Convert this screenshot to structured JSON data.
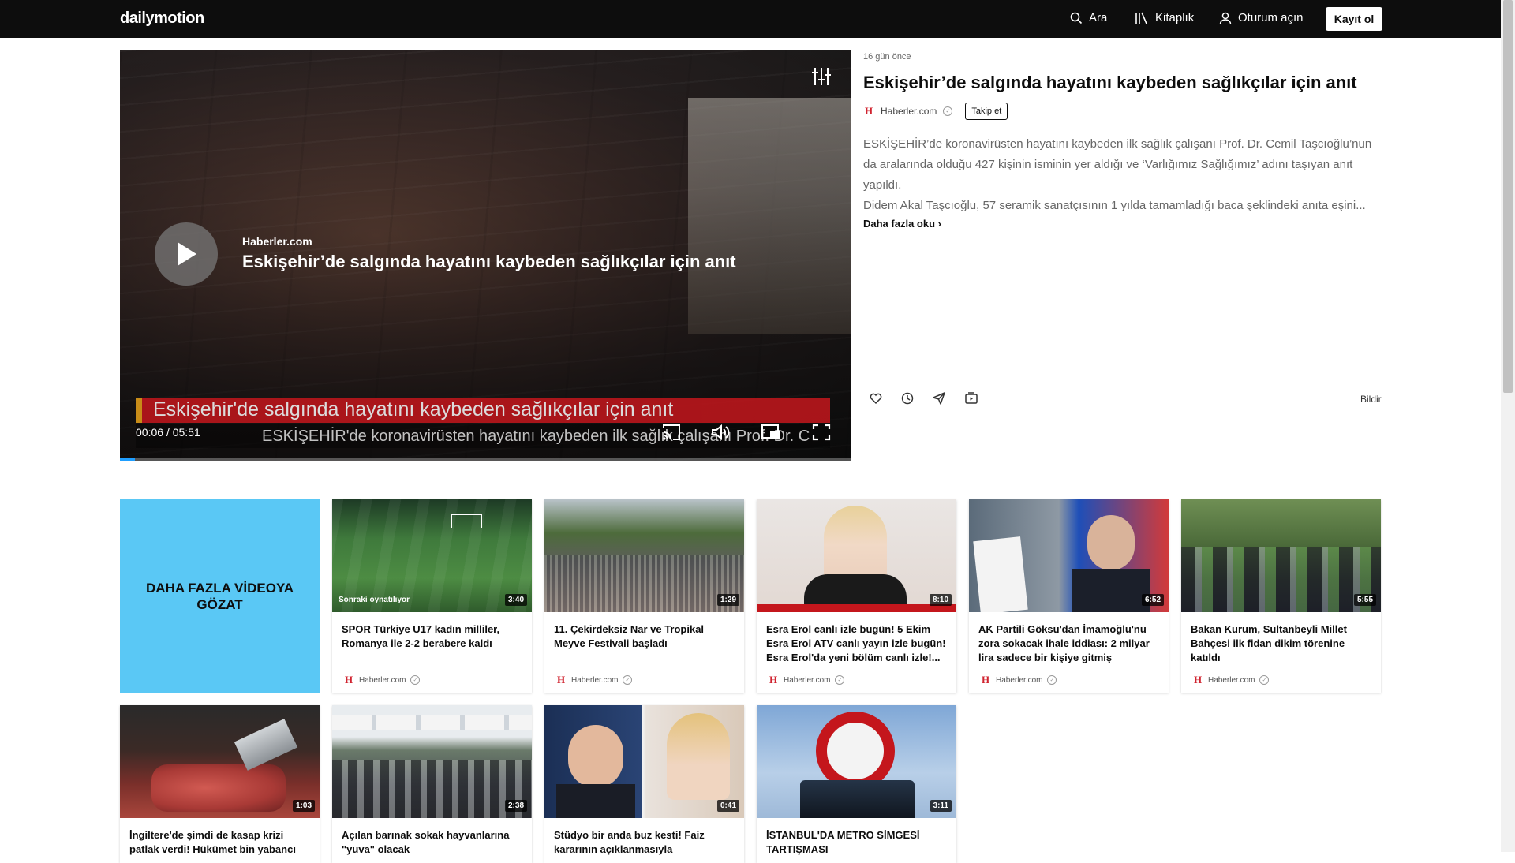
{
  "header": {
    "logo": "dailymotion",
    "search_label": "Ara",
    "library_label": "Kitaplık",
    "login_label": "Oturum açın",
    "signup_label": "Kayıt ol"
  },
  "player": {
    "overlay_channel": "Haberler.com",
    "overlay_title": "Eskişehir’de salgında hayatını kaybeden sağlıkçılar için anıt",
    "banner_text": "Eskişehir'de salgında hayatını kaybeden sağlıkçılar için anıt",
    "ticker_text": "ESKİŞEHİR'de koronavirüsten hayatını kaybeden ilk sağlık çalışanı Prof. Dr. C",
    "time_display": "00:06 / 05:51",
    "progress_percent": 2
  },
  "video": {
    "posted": "16 gün önce",
    "title": "Eskişehir’de salgında hayatını kaybeden sağlıkçılar için anıt",
    "channel": "Haberler.com",
    "follow_label": "Takip et",
    "description_1": "ESKİŞEHİR’de koronavirüsten hayatını kaybeden ilk sağlık çalışanı Prof. Dr. Cemil Taşcıoğlu’nun da aralarında olduğu 427 kişinin isminin yer aldığı ve ‘Varlığımız Sağlığımız’ adını taşıyan anıt yapıldı.",
    "description_2": "Didem Akal Taşcıoğlu, 57 seramik sanatçısının 1 yılda tamamladığı baca şeklindeki anıta eşini...",
    "read_more": "Daha fazla oku",
    "report_label": "Bildir"
  },
  "browse_more": "DAHA FAZLA VİDEOYA GÖZAT",
  "cards": [
    {
      "title": "SPOR Türkiye U17 kadın milliler, Romanya ile 2-2 berabere kaldı",
      "duration": "3:40",
      "channel": "Haberler.com",
      "next_label": "Sonraki oynatılıyor"
    },
    {
      "title": "11. Çekirdeksiz Nar ve Tropikal Meyve Festivali başladı",
      "duration": "1:29",
      "channel": "Haberler.com"
    },
    {
      "title": "Esra Erol canlı izle bugün! 5 Ekim Esra Erol ATV canlı yayın izle bugün! Esra Erol'da yeni bölüm canlı izle!...",
      "duration": "8:10",
      "channel": "Haberler.com"
    },
    {
      "title": "AK Partili Göksu'dan İmamoğlu'nu zora sokacak ihale iddiası: 2 milyar lira sadece bir kişiye gitmiş",
      "duration": "6:52",
      "channel": "Haberler.com"
    },
    {
      "title": "Bakan Kurum, Sultanbeyli Millet Bahçesi ilk fidan dikim törenine katıldı",
      "duration": "5:55",
      "channel": "Haberler.com"
    },
    {
      "title": "İngiltere'de şimdi de kasap krizi patlak verdi! Hükümet bin yabancı",
      "duration": "1:03"
    },
    {
      "title": "Açılan barınak sokak hayvanlarına \"yuva\" olacak",
      "duration": "2:38"
    },
    {
      "title": "Stüdyo bir anda buz kesti! Faiz kararının açıklanmasıyla",
      "duration": "0:41"
    },
    {
      "title": "İSTANBUL'DA METRO SİMGESİ TARTIŞMASI",
      "duration": "3:11"
    }
  ],
  "colors": {
    "header_bg": "#0d0d0d",
    "browse_card": "#5ac8f5",
    "progress": "#1f9eff",
    "haberler_red": "#d0232f"
  }
}
